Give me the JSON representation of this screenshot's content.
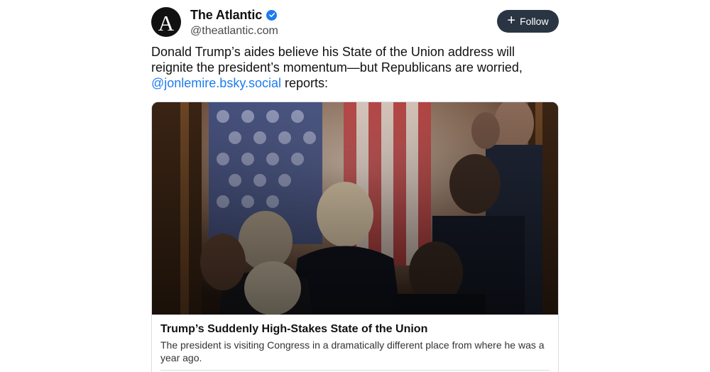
{
  "account": {
    "avatar_letter": "A",
    "display_name": "The Atlantic",
    "handle": "@theatlantic.com"
  },
  "follow_label": "Follow",
  "post": {
    "text_before": "Donald Trump’s aides believe his State of the Union address will reignite the president’s momentum—but Republicans are worried, ",
    "mention": "@jonlemire.bsky.social",
    "text_after": " reports:"
  },
  "link_card": {
    "title": "Trump’s Suddenly High-Stakes State of the Union",
    "description": "The president is visiting Congress in a dramatically different place from where he was a year ago."
  },
  "colors": {
    "accent": "#1d7cf0",
    "button_bg": "#2a3543"
  }
}
